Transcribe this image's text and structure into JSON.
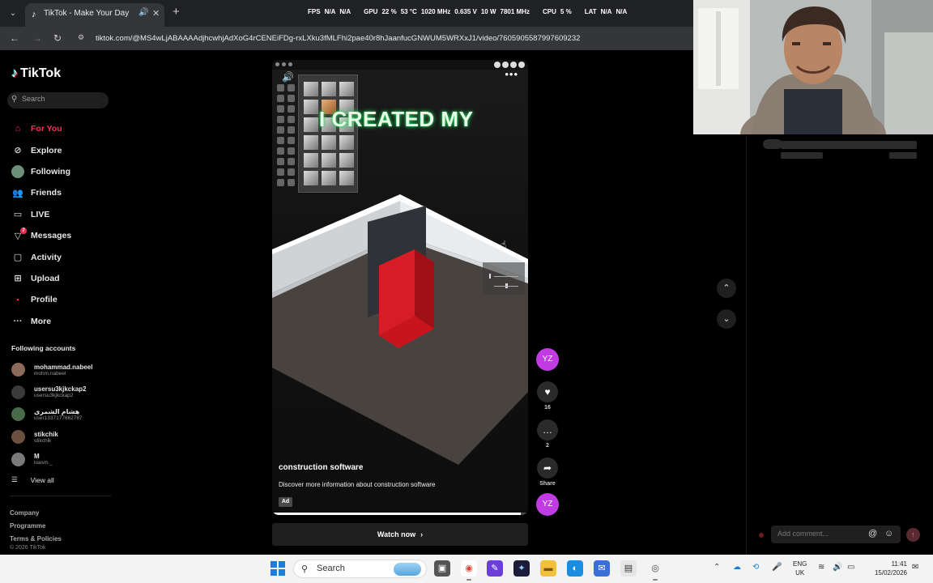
{
  "browser": {
    "tab_title": "TikTok - Make Your Day",
    "url": "tiktok.com/@MS4wLjABAAAAdjhcwhjAdXoG4rCENEiFDg-rxLXku3fMLFhi2pae40r8hJaanfucGNWUM5WRXxJ1/video/7605905587997609232"
  },
  "osd": {
    "fps_label": "FPS",
    "fps_value": "N/A",
    "fps_value2": "N/A",
    "gpu_label": "GPU",
    "gpu_pct": "22 %",
    "gpu_temp": "53 °C",
    "gpu_clock": "1020 MHz",
    "gpu_volt": "0.635 V",
    "gpu_power": "10 W",
    "gpu_mem": "7801 MHz",
    "cpu_label": "CPU",
    "cpu_pct": "5 %",
    "lat_label": "LAT",
    "lat_value": "N/A",
    "lat_value2": "N/A"
  },
  "sidebar": {
    "logo_text": "TikTok",
    "search_placeholder": "Search",
    "nav": [
      {
        "label": "For You"
      },
      {
        "label": "Explore"
      },
      {
        "label": "Following"
      },
      {
        "label": "Friends"
      },
      {
        "label": "LIVE"
      },
      {
        "label": "Messages",
        "badge": "7"
      },
      {
        "label": "Activity"
      },
      {
        "label": "Upload"
      },
      {
        "label": "Profile"
      },
      {
        "label": "More"
      }
    ],
    "following_title": "Following accounts",
    "following": [
      {
        "name": "mohammad.nabeel",
        "handle": "mohm.nabeel",
        "color": "#8c6a5a"
      },
      {
        "name": "usersu3kjkckap2",
        "handle": "usersu3kjkckap2",
        "color": "#3a3a3a"
      },
      {
        "name": "هشام الشمري",
        "handle": "user1337177662787",
        "color": "#4a6b4a"
      },
      {
        "name": "stikchik",
        "handle": "stikchik",
        "color": "#6b5040"
      },
      {
        "name": "M",
        "handle": "loasm._",
        "color": "#7a7a7a"
      }
    ],
    "view_all": "View all",
    "footer": [
      "Company",
      "Programme",
      "Terms & Policies"
    ],
    "copyright": "© 2026 TikTok"
  },
  "video": {
    "overlay_text": "I CREATED MY",
    "title": "construction software",
    "description": "Discover more information about construction software",
    "ad_label": "Ad",
    "progress": 0.97,
    "cta": "Watch now"
  },
  "actions": {
    "avatar_initials": "YZ",
    "likes": "16",
    "comments": "2",
    "share": "Share"
  },
  "comments_panel": {
    "placeholder": "Add comment..."
  },
  "taskbar": {
    "search_placeholder": "Search",
    "lang_top": "ENG",
    "lang_bottom": "UK",
    "time": "11:41",
    "date": "15/02/2026"
  },
  "colors": {
    "accent": "#fe2c55",
    "avatar_bg": "#c13be3",
    "overlay_glow": "#2fd65a"
  }
}
